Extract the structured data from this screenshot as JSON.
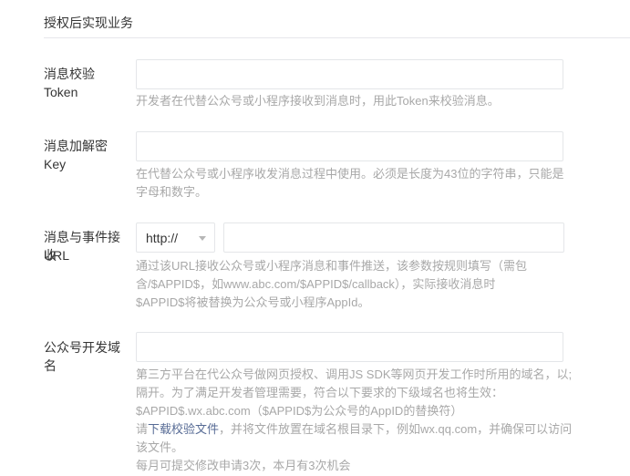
{
  "section": {
    "title": "授权后实现业务"
  },
  "fields": {
    "token": {
      "label": "消息校验Token",
      "value": "",
      "hint": "开发者在代替公众号或小程序接收到消息时，用此Token来校验消息。"
    },
    "aes_key": {
      "label": "消息加解密Key",
      "value": "",
      "hint_line1": "在代替公众号或小程序收发消息过程中使用。必须是长度为43位的字符串，只能是",
      "hint_line2": "字母和数字。"
    },
    "event_url": {
      "label_line1": "消息与事件接收",
      "label_line2": "URL",
      "protocol_selected": "http://",
      "value": "",
      "hint_line1": "通过该URL接收公众号或小程序消息和事件推送，该参数按规则填写（需包",
      "hint_line2": "含/$APPID$，如www.abc.com/$APPID$/callback），实际接收消息时",
      "hint_line3": "$APPID$将被替换为公众号或小程序AppId。"
    },
    "domain": {
      "label": "公众号开发域名",
      "value": "",
      "hint_line1": "第三方平台在代公众号做网页授权、调用JS SDK等网页开发工作时所用的域名，以;",
      "hint_line2": "隔开。为了满足开发者管理需要，符合以下要求的下级域名也将生效：",
      "hint_line3": "$APPID$.wx.abc.com（$APPID$为公众号的AppID的替换符）",
      "hint_line4_prefix": "请",
      "hint_line4_link": "下载校验文件",
      "hint_line4_suffix": "，并将文件放置在域名根目录下，例如wx.qq.com，并确保可以访问",
      "hint_line5": "该文件。",
      "hint_line6": "每月可提交修改申请3次，本月有3次机会"
    }
  },
  "colors": {
    "hint": "#a8a8a8",
    "link": "#576b95",
    "border": "#e4e6e9",
    "text": "#353535"
  }
}
